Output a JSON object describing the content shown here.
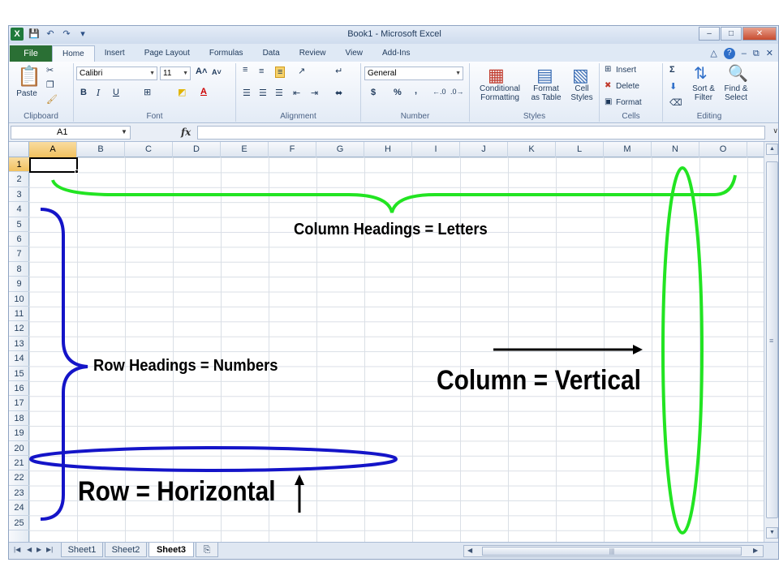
{
  "window": {
    "title": "Book1 - Microsoft Excel",
    "app_icon": "X",
    "qat_icons": [
      "save-icon",
      "undo-icon",
      "redo-icon",
      "customize-icon"
    ]
  },
  "tabs": {
    "file": "File",
    "items": [
      "Home",
      "Insert",
      "Page Layout",
      "Formulas",
      "Data",
      "Review",
      "View",
      "Add-Ins"
    ],
    "active": "Home"
  },
  "ribbon": {
    "clipboard": {
      "label": "Clipboard",
      "paste": "Paste"
    },
    "font": {
      "label": "Font",
      "name": "Calibri",
      "size": "11",
      "bold": "B",
      "italic": "I",
      "underline": "U"
    },
    "alignment": {
      "label": "Alignment"
    },
    "number": {
      "label": "Number",
      "format": "General",
      "currency": "$",
      "percent": "%",
      "comma": ","
    },
    "styles": {
      "label": "Styles",
      "conditional": "Conditional Formatting",
      "format_table": "Format as Table",
      "cell_styles": "Cell Styles"
    },
    "cells": {
      "label": "Cells",
      "insert": "Insert",
      "delete": "Delete",
      "format": "Format"
    },
    "editing": {
      "label": "Editing",
      "sigma": "Σ",
      "sort": "Sort & Filter",
      "find": "Find & Select"
    }
  },
  "formula_bar": {
    "name_box": "A1",
    "fx": "fx",
    "value": ""
  },
  "grid": {
    "columns": [
      "A",
      "B",
      "C",
      "D",
      "E",
      "F",
      "G",
      "H",
      "I",
      "J",
      "K",
      "L",
      "M",
      "N",
      "O"
    ],
    "rows": [
      "1",
      "2",
      "3",
      "4",
      "5",
      "6",
      "7",
      "8",
      "9",
      "10",
      "11",
      "12",
      "13",
      "14",
      "15",
      "16",
      "17",
      "18",
      "19",
      "20",
      "21",
      "22",
      "23",
      "24",
      "25"
    ],
    "selected_cell": "A1"
  },
  "sheets": {
    "tabs": [
      "Sheet1",
      "Sheet2",
      "Sheet3"
    ],
    "active": "Sheet3"
  },
  "annotations": {
    "column_headings": "Column Headings = Letters",
    "row_headings": "Row Headings =  Numbers",
    "column_vertical": "Column = Vertical",
    "row_horizontal": "Row = Horizontal",
    "colors": {
      "green": "#22e422",
      "blue": "#1414c8",
      "black": "#000000"
    }
  }
}
